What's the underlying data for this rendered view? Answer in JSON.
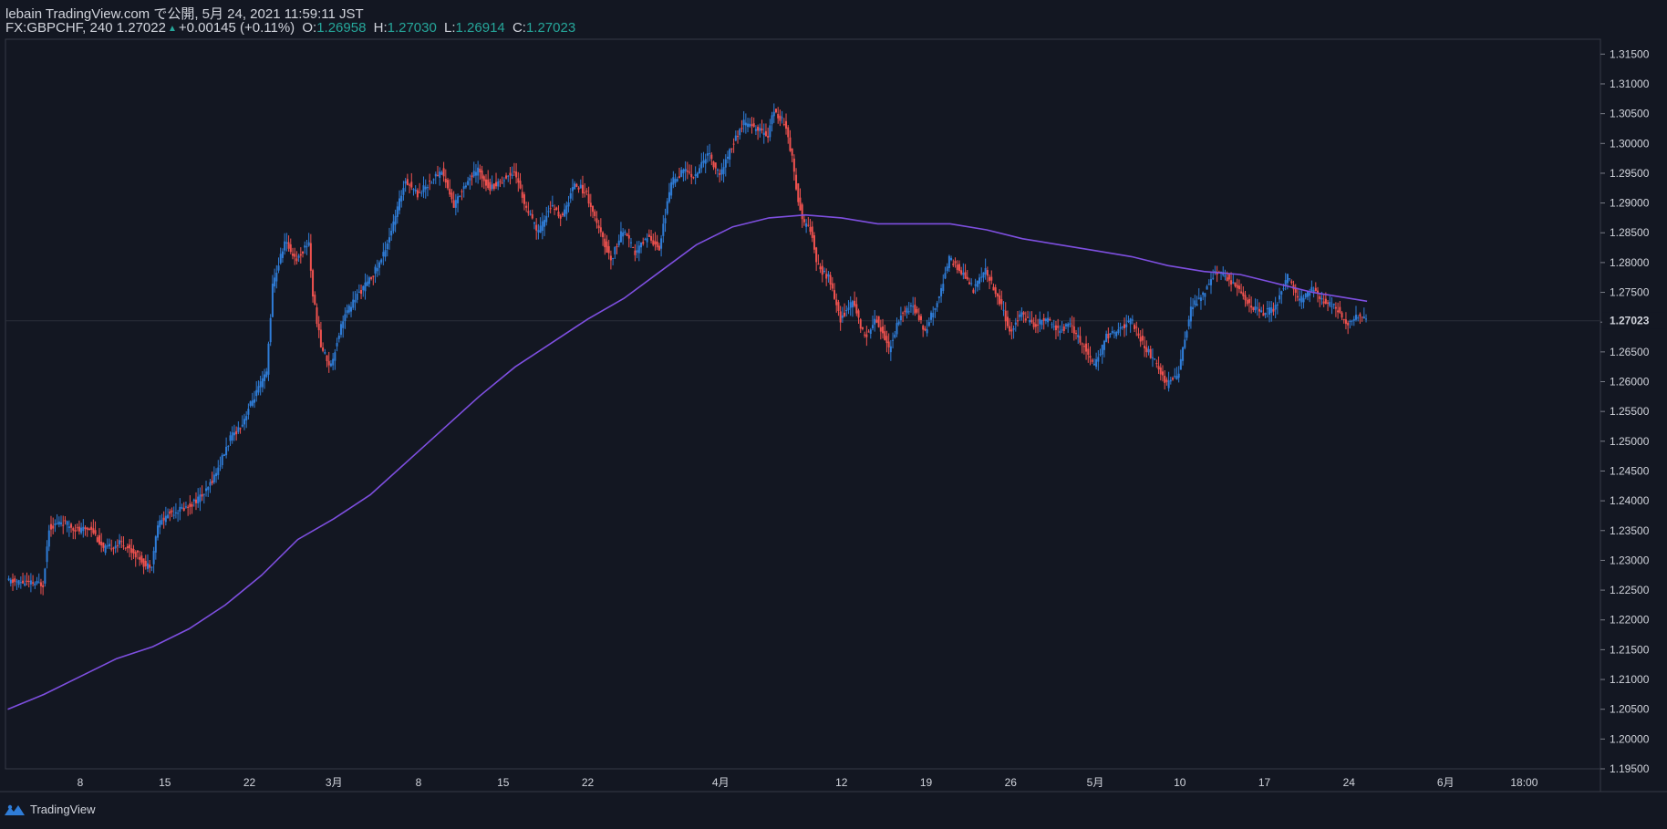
{
  "header": {
    "published": "lebain TradingView.com で公開, 5月 24, 2021 11:59:11 JST",
    "symbol": "FX:GBPCHF, 240",
    "last": "1.27022",
    "change": "+0.00145 (+0.11%)",
    "o_label": "O:",
    "o_value": "1.26958",
    "h_label": "H:",
    "h_value": "1.27030",
    "l_label": "L:",
    "l_value": "1.26914",
    "c_label": "C:",
    "c_value": "1.27023"
  },
  "footer": {
    "brand": "TradingView",
    "logo_icon": "tradingview-logo-icon"
  },
  "colors": {
    "background": "#131722",
    "up": "#2f7dd8",
    "down": "#f0524f",
    "ma": "#7e4fe0",
    "grid_text": "#d1d4dc",
    "price_tag": "#131722",
    "accent_green": "#26a69a"
  },
  "chart_data": {
    "type": "candlestick",
    "title": "FX:GBPCHF, 240",
    "ylim": [
      1.195,
      1.3175
    ],
    "y_ticks": [
      1.195,
      1.2,
      1.205,
      1.21,
      1.215,
      1.22,
      1.225,
      1.23,
      1.235,
      1.24,
      1.245,
      1.25,
      1.255,
      1.26,
      1.265,
      1.27,
      1.275,
      1.28,
      1.285,
      1.29,
      1.295,
      1.3,
      1.305,
      1.31,
      1.315
    ],
    "y_tick_labels": [
      "1.19500",
      "1.20000",
      "1.20500",
      "1.21000",
      "1.21500",
      "1.22000",
      "1.22500",
      "1.23000",
      "1.23500",
      "1.24000",
      "1.24500",
      "1.25000",
      "1.25500",
      "1.26000",
      "1.26500",
      "1.27000",
      "1.27500",
      "1.28000",
      "1.28500",
      "1.29000",
      "1.29500",
      "1.30000",
      "1.30500",
      "1.31000",
      "1.31500"
    ],
    "x_range_days": [
      0,
      124
    ],
    "x_ticks": [
      {
        "day": 6,
        "label": "8"
      },
      {
        "day": 13,
        "label": "15"
      },
      {
        "day": 20,
        "label": "22"
      },
      {
        "day": 27,
        "label": "3月"
      },
      {
        "day": 34,
        "label": "8"
      },
      {
        "day": 41,
        "label": "15"
      },
      {
        "day": 48,
        "label": "22"
      },
      {
        "day": 59,
        "label": "4月"
      },
      {
        "day": 69,
        "label": "12"
      },
      {
        "day": 76,
        "label": "19"
      },
      {
        "day": 83,
        "label": "26"
      },
      {
        "day": 90,
        "label": "5月"
      },
      {
        "day": 97,
        "label": "10"
      },
      {
        "day": 104,
        "label": "17"
      },
      {
        "day": 111,
        "label": "24"
      },
      {
        "day": 119,
        "label": "6月"
      },
      {
        "day": 125.5,
        "label": "18:00"
      }
    ],
    "current_price": 1.27023,
    "current_price_label": "1.27023",
    "price_anchors": [
      [
        0,
        1.2265
      ],
      [
        3,
        1.226
      ],
      [
        3.5,
        1.2355
      ],
      [
        4.5,
        1.2365
      ],
      [
        6,
        1.235
      ],
      [
        7,
        1.2355
      ],
      [
        8,
        1.2318
      ],
      [
        9.5,
        1.233
      ],
      [
        11,
        1.2305
      ],
      [
        11.5,
        1.229
      ],
      [
        12,
        1.2295
      ],
      [
        12.5,
        1.236
      ],
      [
        13.5,
        1.238
      ],
      [
        15,
        1.239
      ],
      [
        16.5,
        1.2415
      ],
      [
        17.5,
        1.2455
      ],
      [
        18.5,
        1.2505
      ],
      [
        19.5,
        1.253
      ],
      [
        20,
        1.2555
      ],
      [
        21,
        1.2595
      ],
      [
        21.5,
        1.2615
      ],
      [
        22,
        1.276
      ],
      [
        23,
        1.2835
      ],
      [
        24,
        1.2805
      ],
      [
        25,
        1.2835
      ],
      [
        25.3,
        1.275
      ],
      [
        26,
        1.266
      ],
      [
        26.8,
        1.2625
      ],
      [
        27.8,
        1.2705
      ],
      [
        29,
        1.2745
      ],
      [
        30,
        1.277
      ],
      [
        31,
        1.2805
      ],
      [
        32,
        1.2865
      ],
      [
        33,
        1.294
      ],
      [
        34,
        1.2915
      ],
      [
        35,
        1.2935
      ],
      [
        36,
        1.2955
      ],
      [
        37,
        1.2895
      ],
      [
        38,
        1.2935
      ],
      [
        39,
        1.2955
      ],
      [
        40,
        1.2925
      ],
      [
        41.5,
        1.2945
      ],
      [
        42,
        1.2955
      ],
      [
        43,
        1.289
      ],
      [
        44,
        1.285
      ],
      [
        45,
        1.2895
      ],
      [
        46,
        1.2875
      ],
      [
        47,
        1.2935
      ],
      [
        48,
        1.2915
      ],
      [
        49,
        1.2855
      ],
      [
        50,
        1.2805
      ],
      [
        51,
        1.2855
      ],
      [
        52,
        1.2815
      ],
      [
        53,
        1.2845
      ],
      [
        54,
        1.2825
      ],
      [
        55,
        1.2935
      ],
      [
        56,
        1.2955
      ],
      [
        57,
        1.2945
      ],
      [
        58,
        1.2985
      ],
      [
        59,
        1.2945
      ],
      [
        60,
        1.2995
      ],
      [
        61,
        1.3035
      ],
      [
        62,
        1.3025
      ],
      [
        63,
        1.3015
      ],
      [
        63.5,
        1.3055
      ],
      [
        64.5,
        1.303
      ],
      [
        65,
        1.2975
      ],
      [
        65.5,
        1.2905
      ],
      [
        66,
        1.2865
      ],
      [
        66.6,
        1.2855
      ],
      [
        67,
        1.2795
      ],
      [
        68,
        1.2775
      ],
      [
        69,
        1.2705
      ],
      [
        70,
        1.2735
      ],
      [
        71,
        1.2675
      ],
      [
        72,
        1.2705
      ],
      [
        73,
        1.2655
      ],
      [
        74,
        1.2715
      ],
      [
        75,
        1.2725
      ],
      [
        76,
        1.2685
      ],
      [
        77,
        1.2735
      ],
      [
        78,
        1.2805
      ],
      [
        79,
        1.2785
      ],
      [
        80,
        1.2755
      ],
      [
        81,
        1.2785
      ],
      [
        82,
        1.2745
      ],
      [
        83,
        1.2685
      ],
      [
        84,
        1.2715
      ],
      [
        85,
        1.2695
      ],
      [
        86,
        1.2705
      ],
      [
        87,
        1.2685
      ],
      [
        88,
        1.2695
      ],
      [
        89,
        1.2665
      ],
      [
        90,
        1.2625
      ],
      [
        91,
        1.2675
      ],
      [
        92,
        1.2685
      ],
      [
        93,
        1.2705
      ],
      [
        94,
        1.2665
      ],
      [
        95,
        1.2635
      ],
      [
        96,
        1.2595
      ],
      [
        97,
        1.2615
      ],
      [
        98,
        1.2725
      ],
      [
        99,
        1.2745
      ],
      [
        100,
        1.2785
      ],
      [
        101,
        1.2775
      ],
      [
        102,
        1.2755
      ],
      [
        103,
        1.2725
      ],
      [
        104,
        1.2715
      ],
      [
        105,
        1.2725
      ],
      [
        106,
        1.2775
      ],
      [
        107,
        1.2735
      ],
      [
        108,
        1.2755
      ],
      [
        109,
        1.2735
      ],
      [
        110,
        1.2725
      ],
      [
        111,
        1.2695
      ],
      [
        112,
        1.2715
      ],
      [
        112.5,
        1.27022
      ]
    ],
    "ma_anchors": [
      [
        0,
        1.205
      ],
      [
        3,
        1.2075
      ],
      [
        6,
        1.2105
      ],
      [
        9,
        1.2135
      ],
      [
        12,
        1.2155
      ],
      [
        15,
        1.2185
      ],
      [
        18,
        1.2225
      ],
      [
        21,
        1.2275
      ],
      [
        24,
        1.2335
      ],
      [
        27,
        1.237
      ],
      [
        30,
        1.241
      ],
      [
        33,
        1.2465
      ],
      [
        36,
        1.252
      ],
      [
        39,
        1.2575
      ],
      [
        42,
        1.2625
      ],
      [
        45,
        1.2665
      ],
      [
        48,
        1.2705
      ],
      [
        51,
        1.274
      ],
      [
        54,
        1.2785
      ],
      [
        57,
        1.283
      ],
      [
        60,
        1.286
      ],
      [
        63,
        1.2875
      ],
      [
        66,
        1.288
      ],
      [
        69,
        1.2875
      ],
      [
        72,
        1.2865
      ],
      [
        75,
        1.2865
      ],
      [
        78,
        1.2865
      ],
      [
        81,
        1.2855
      ],
      [
        84,
        1.284
      ],
      [
        87,
        1.283
      ],
      [
        90,
        1.282
      ],
      [
        93,
        1.281
      ],
      [
        96,
        1.2795
      ],
      [
        99,
        1.2785
      ],
      [
        102,
        1.278
      ],
      [
        105,
        1.2765
      ],
      [
        108,
        1.275
      ],
      [
        111,
        1.274
      ],
      [
        112.5,
        1.2735
      ]
    ]
  }
}
